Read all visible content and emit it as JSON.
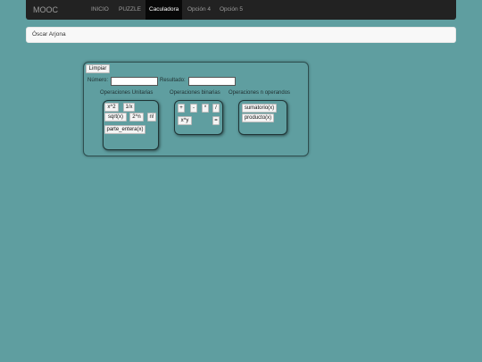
{
  "navbar": {
    "brand": "MOOC",
    "items": [
      {
        "label": "INICIO"
      },
      {
        "label": "PUZZLE"
      },
      {
        "label": "Caculadora"
      },
      {
        "label": "Opción 4"
      },
      {
        "label": "Opción 5"
      }
    ]
  },
  "user": {
    "name": "Óscar Arjona"
  },
  "calculator": {
    "clear_label": "Limpiar",
    "number_label": "Número:",
    "number_value": "",
    "result_label": "Resultado:",
    "result_value": "",
    "unary": {
      "title": "Operaciones Unitarias",
      "buttons": [
        "x^2",
        "1/x",
        "sqrt(x)",
        "2^n",
        "n!",
        "parte_entera(x)"
      ]
    },
    "binary": {
      "title": "Operaciones binarias",
      "buttons": [
        "+",
        "-",
        "*",
        "/",
        "x^y",
        "="
      ]
    },
    "nary": {
      "title": "Operaciones n operandos",
      "buttons": [
        "sumatorio(x)",
        "producto(x)"
      ]
    }
  },
  "colors": {
    "background": "#5f9ea0",
    "navbar": "#222222",
    "active_tab": "#080808"
  }
}
